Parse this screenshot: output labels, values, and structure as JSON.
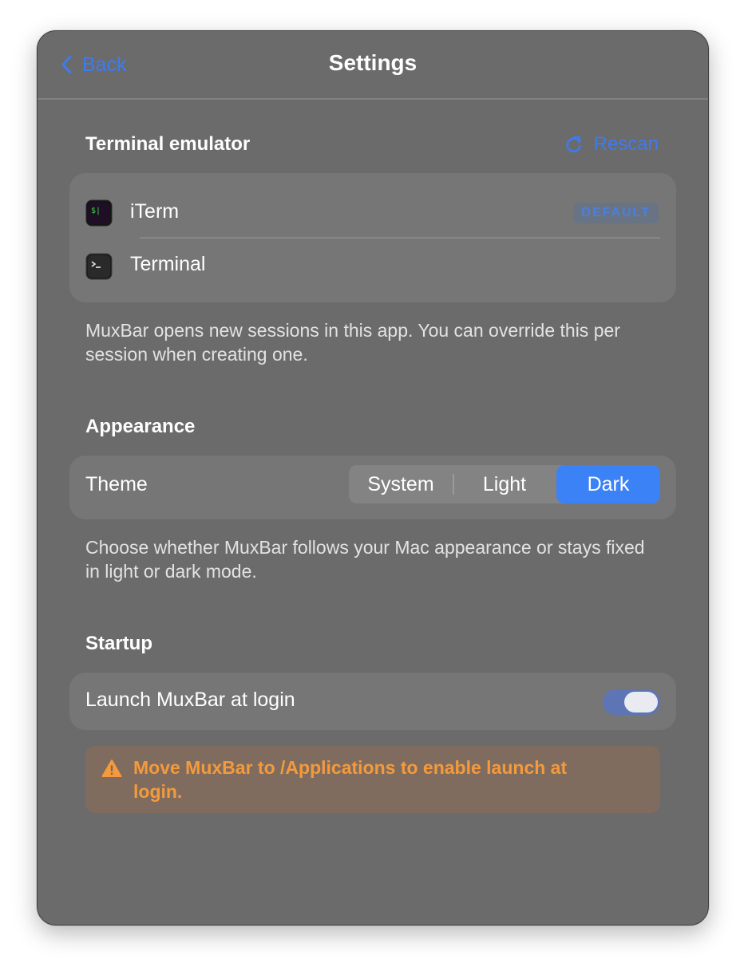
{
  "header": {
    "back_label": "Back",
    "title": "Settings"
  },
  "terminal": {
    "section_title": "Terminal emulator",
    "rescan_label": "Rescan",
    "apps": [
      {
        "name": "iTerm",
        "icon": "iterm-icon",
        "badge": "DEFAULT"
      },
      {
        "name": "Terminal",
        "icon": "terminal-icon"
      }
    ],
    "help_text": "MuxBar opens new sessions in this app. You can override this per session when creating one."
  },
  "appearance": {
    "section_title": "Appearance",
    "theme_label": "Theme",
    "options": [
      "System",
      "Light",
      "Dark"
    ],
    "selected": "Dark",
    "help_text": "Choose whether MuxBar follows your Mac appearance or stays fixed in light or dark mode."
  },
  "startup": {
    "section_title": "Startup",
    "launch_label": "Launch MuxBar at login",
    "launch_enabled": true,
    "warning_text": "Move MuxBar to /Applications to enable launch at login."
  },
  "colors": {
    "accent": "#3c82f7",
    "window_bg": "#6b6b6b",
    "card_bg": "#767676",
    "warning_text": "#f49a3c",
    "warning_bg": "#7f6c5e"
  }
}
